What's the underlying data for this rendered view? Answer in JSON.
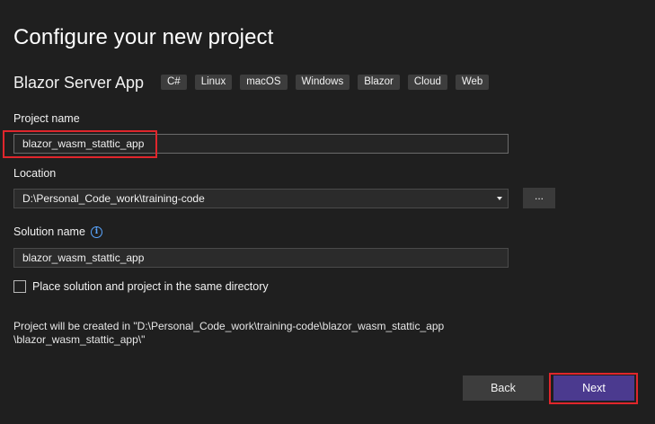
{
  "dialog": {
    "title": "Configure your new project",
    "template_name": "Blazor Server App",
    "tags": [
      "C#",
      "Linux",
      "macOS",
      "Windows",
      "Blazor",
      "Cloud",
      "Web"
    ]
  },
  "project_name": {
    "label": "Project name",
    "value": "blazor_wasm_stattic_app"
  },
  "location": {
    "label": "Location",
    "value": "D:\\Personal_Code_work\\training-code",
    "browse_label": "..."
  },
  "solution_name": {
    "label": "Solution name",
    "value": "blazor_wasm_stattic_app",
    "info_icon": "info-icon"
  },
  "same_directory": {
    "label": "Place solution and project in the same directory",
    "checked": false
  },
  "created_path": {
    "line1": "Project will be created in \"D:\\Personal_Code_work\\training-code\\blazor_wasm_stattic_app",
    "line2": "\\blazor_wasm_stattic_app\\\""
  },
  "buttons": {
    "back": "Back",
    "next": "Next"
  },
  "colors": {
    "background": "#1f1f1f",
    "accent": "#4b3a8f",
    "highlight": "#e0262c",
    "info": "#5aa6ff"
  }
}
